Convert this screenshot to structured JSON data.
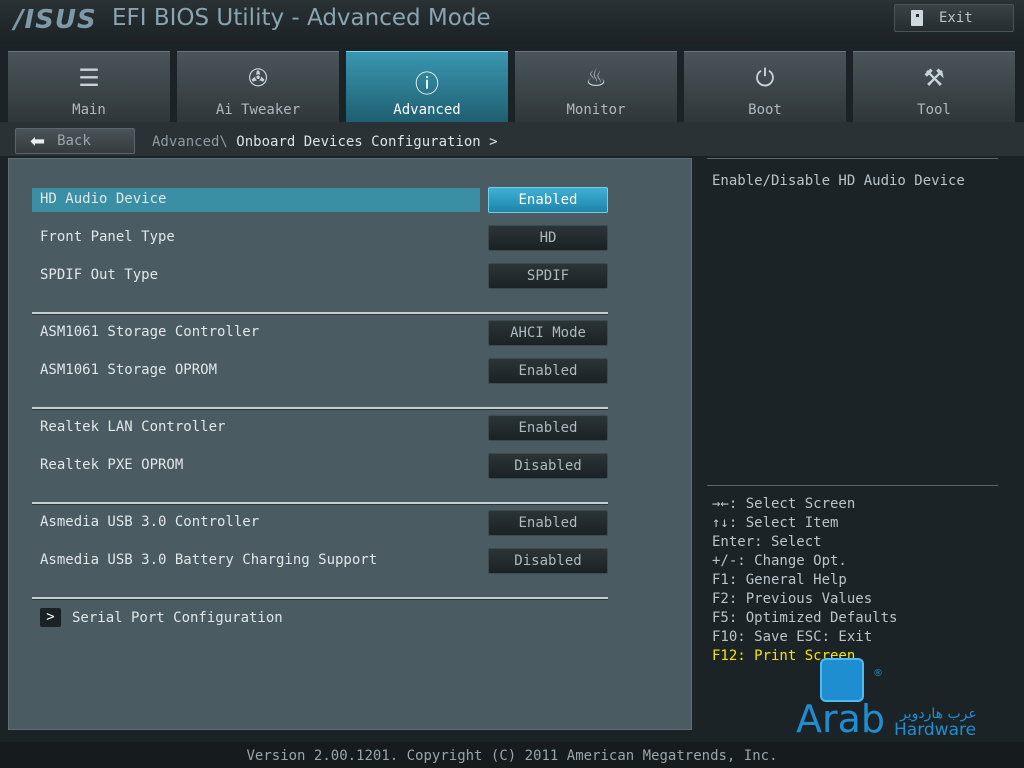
{
  "title_bar": {
    "brand": "/ISUS",
    "title": "EFI BIOS Utility - Advanced Mode",
    "exit_label": "Exit"
  },
  "tabs": [
    {
      "label": "Main",
      "icon": "list-icon",
      "glyph": "☰",
      "active": false
    },
    {
      "label": "Ai Tweaker",
      "icon": "tweaker-icon",
      "glyph": "✇",
      "active": false
    },
    {
      "label": "Advanced",
      "icon": "advanced-info-icon",
      "glyph": "ⓘ",
      "active": true
    },
    {
      "label": "Monitor",
      "icon": "thermometer-icon",
      "glyph": "♨",
      "active": false
    },
    {
      "label": "Boot",
      "icon": "power-icon",
      "glyph": "⏻",
      "active": false
    },
    {
      "label": "Tool",
      "icon": "toolbox-icon",
      "glyph": "⚒",
      "active": false
    }
  ],
  "nav": {
    "back_label": "Back",
    "breadcrumb_parent": "Advanced\\",
    "breadcrumb_current": "Onboard Devices Configuration",
    "breadcrumb_suffix": ">"
  },
  "settings": [
    {
      "label": "HD Audio Device",
      "value": "Enabled",
      "selected": true
    },
    {
      "label": "Front Panel Type",
      "value": "HD"
    },
    {
      "label": "SPDIF Out Type",
      "value": "SPDIF"
    },
    {
      "label": "ASM1061 Storage Controller",
      "value": "AHCI Mode"
    },
    {
      "label": "ASM1061 Storage OPROM",
      "value": "Enabled"
    },
    {
      "label": "Realtek LAN Controller",
      "value": "Enabled"
    },
    {
      "label": "Realtek PXE OPROM",
      "value": "Disabled"
    },
    {
      "label": "Asmedia USB 3.0 Controller",
      "value": "Enabled"
    },
    {
      "label": "Asmedia USB 3.0 Battery Charging Support",
      "value": "Disabled"
    }
  ],
  "submenu": {
    "label": "Serial Port Configuration",
    "arrow": ">"
  },
  "help": {
    "description": "Enable/Disable HD Audio Device",
    "keys": [
      "→←: Select Screen",
      "↑↓: Select Item",
      "Enter: Select",
      "+/-: Change Opt.",
      "F1: General Help",
      "F2: Previous Values",
      "F5: Optimized Defaults",
      "F10: Save  ESC: Exit"
    ],
    "hotkey": "F12: Print Screen"
  },
  "watermark": {
    "brand": "Arab",
    "arabic": "عرب هاردوير",
    "sub": "Hardware",
    "mark": "®"
  },
  "footer": {
    "version": "Version 2.00.1201. Copyright (C) 2011 American Megatrends, Inc."
  },
  "colors": {
    "accent": "#3b8fa5",
    "active_tab": "#2a7f97",
    "hotkey": "#f2e600",
    "watermark": "#1f8ed0"
  }
}
